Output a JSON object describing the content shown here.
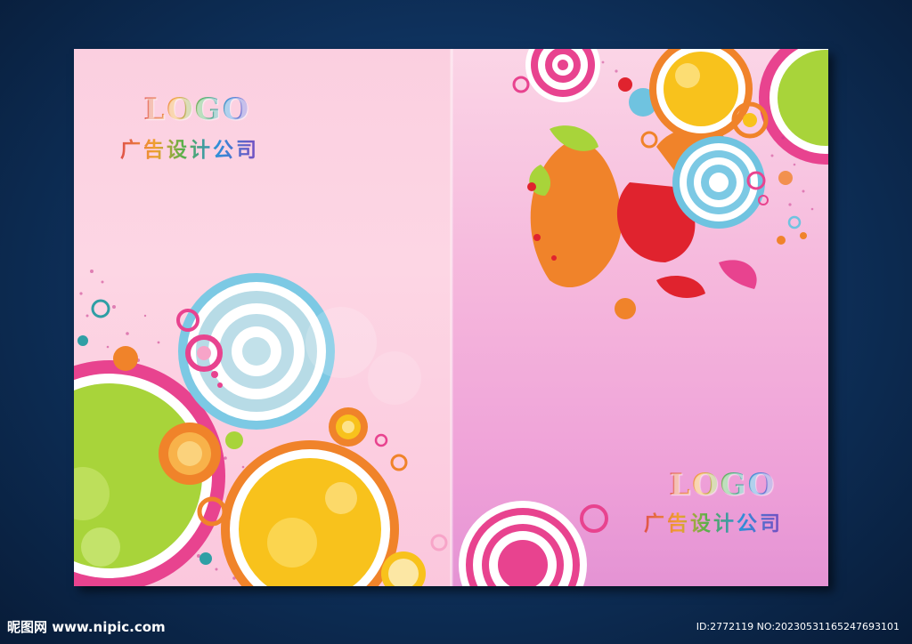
{
  "brochure": {
    "left_page": {
      "logo": "LOGO",
      "company": "广告设计公司"
    },
    "right_page": {
      "logo": "LOGO",
      "company": "广告设计公司"
    }
  },
  "watermark": {
    "site": "昵图网 www.nipic.com",
    "id": "ID:2772119 NO:20230531165247693101"
  },
  "colors": {
    "background": "#0f3461",
    "accent_pink": "#e8438f",
    "accent_yellow": "#f8c21c",
    "accent_blue": "#6fc3e0",
    "accent_green": "#a8d43a",
    "accent_orange": "#f0832a"
  }
}
